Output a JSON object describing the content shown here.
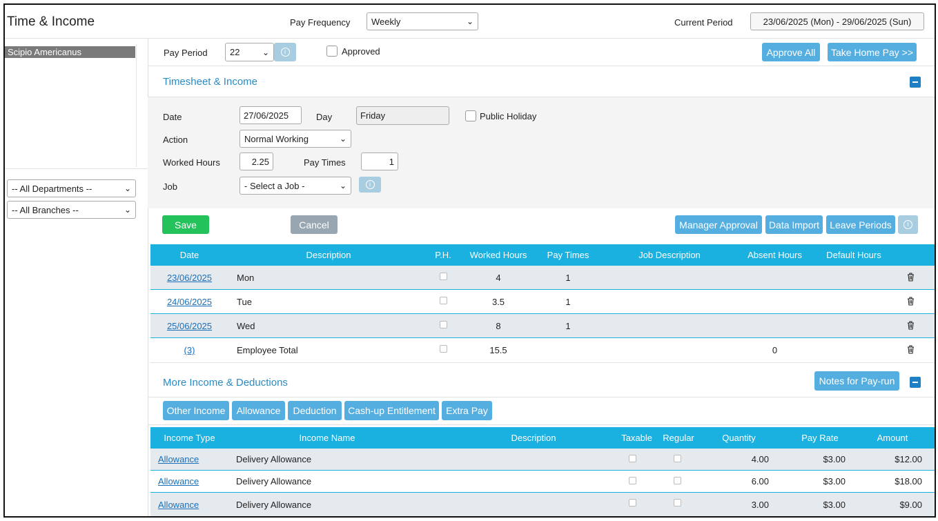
{
  "app": {
    "title": "Time & Income"
  },
  "header": {
    "pay_frequency_label": "Pay Frequency",
    "pay_frequency_value": "Weekly",
    "current_period_label": "Current Period",
    "current_period_value": "23/06/2025 (Mon) - 29/06/2025 (Sun)"
  },
  "sidebar": {
    "employees": [
      {
        "name": "Scipio Americanus"
      }
    ],
    "department_filter": "-- All Departments --",
    "branch_filter": "-- All Branches --"
  },
  "pay_period": {
    "label": "Pay Period",
    "value": "22",
    "approved_label": "Approved",
    "approve_all": "Approve All",
    "take_home_pay": "Take Home Pay >>"
  },
  "timesheet": {
    "section_title": "Timesheet & Income",
    "date_label": "Date",
    "date_value": "27/06/2025",
    "day_label": "Day",
    "day_value": "Friday",
    "public_holiday_label": "Public Holiday",
    "action_label": "Action",
    "action_value": "Normal Working",
    "worked_hours_label": "Worked Hours",
    "worked_hours_value": "2.25",
    "pay_times_label": "Pay Times",
    "pay_times_value": "1",
    "job_label": "Job",
    "job_value": "- Select a Job -",
    "save": "Save",
    "cancel": "Cancel",
    "manager_approval": "Manager Approval",
    "data_import": "Data Import",
    "leave_periods": "Leave Periods",
    "columns": [
      "Date",
      "Description",
      "P.H.",
      "Worked Hours",
      "Pay Times",
      "Job Description",
      "Absent Hours",
      "Default Hours"
    ],
    "rows": [
      {
        "date": "23/06/2025",
        "description": "Mon",
        "worked_hours": "4",
        "pay_times": "1",
        "absent_hours": ""
      },
      {
        "date": "24/06/2025",
        "description": "Tue",
        "worked_hours": "3.5",
        "pay_times": "1",
        "absent_hours": ""
      },
      {
        "date": "25/06/2025",
        "description": "Wed",
        "worked_hours": "8",
        "pay_times": "1",
        "absent_hours": ""
      },
      {
        "date": "(3)",
        "description": "Employee Total",
        "worked_hours": "15.5",
        "pay_times": "",
        "absent_hours": "0"
      }
    ]
  },
  "income": {
    "section_title": "More Income & Deductions",
    "notes_button": "Notes for Pay-run",
    "tabs": [
      "Other Income",
      "Allowance",
      "Deduction",
      "Cash-up Entitlement",
      "Extra Pay"
    ],
    "columns": [
      "Income Type",
      "Income Name",
      "Description",
      "Taxable",
      "Regular",
      "Quantity",
      "Pay Rate",
      "Amount"
    ],
    "rows": [
      {
        "type": "Allowance",
        "name": "Delivery Allowance",
        "description": "",
        "quantity": "4.00",
        "rate": "$3.00",
        "amount": "$12.00"
      },
      {
        "type": "Allowance",
        "name": "Delivery Allowance",
        "description": "",
        "quantity": "6.00",
        "rate": "$3.00",
        "amount": "$18.00"
      },
      {
        "type": "Allowance",
        "name": "Delivery Allowance",
        "description": "",
        "quantity": "3.00",
        "rate": "$3.00",
        "amount": "$9.00"
      }
    ]
  },
  "colors": {
    "accent": "#1ab0e0",
    "button": "#55aee0",
    "save": "#23c25b",
    "cancel": "#98a6b1",
    "link": "#1a6fb8"
  }
}
